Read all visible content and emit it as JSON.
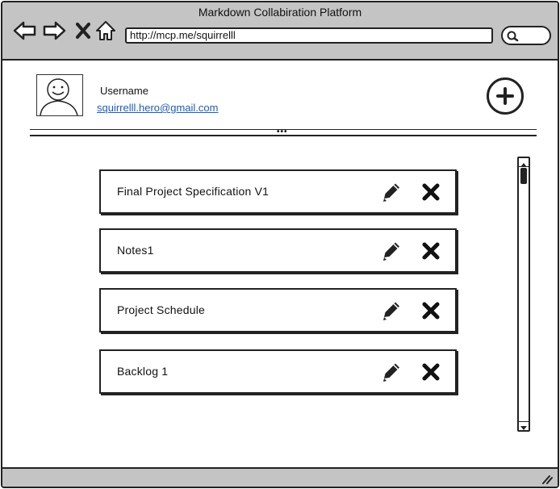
{
  "window": {
    "title": "Markdown Collabiration Platform",
    "url": "http://mcp.me/squirrelll",
    "search_value": ""
  },
  "icons": {
    "back": "arrow-left-icon",
    "forward": "arrow-right-icon",
    "stop": "close-icon",
    "home": "home-icon",
    "search": "search-icon",
    "add": "plus-circle-icon",
    "edit": "pencil-icon",
    "delete": "x-icon",
    "avatar": "user-avatar-icon"
  },
  "user": {
    "name": "Username",
    "email": "squirrelll.hero@gmail.com"
  },
  "documents": [
    {
      "title": "Final Project Specification V1"
    },
    {
      "title": "Notes1"
    },
    {
      "title": "Project Schedule"
    },
    {
      "title": "Backlog 1"
    }
  ],
  "colors": {
    "chrome": "#c4c4c4",
    "link": "#1e5db5",
    "ink": "#222222"
  }
}
